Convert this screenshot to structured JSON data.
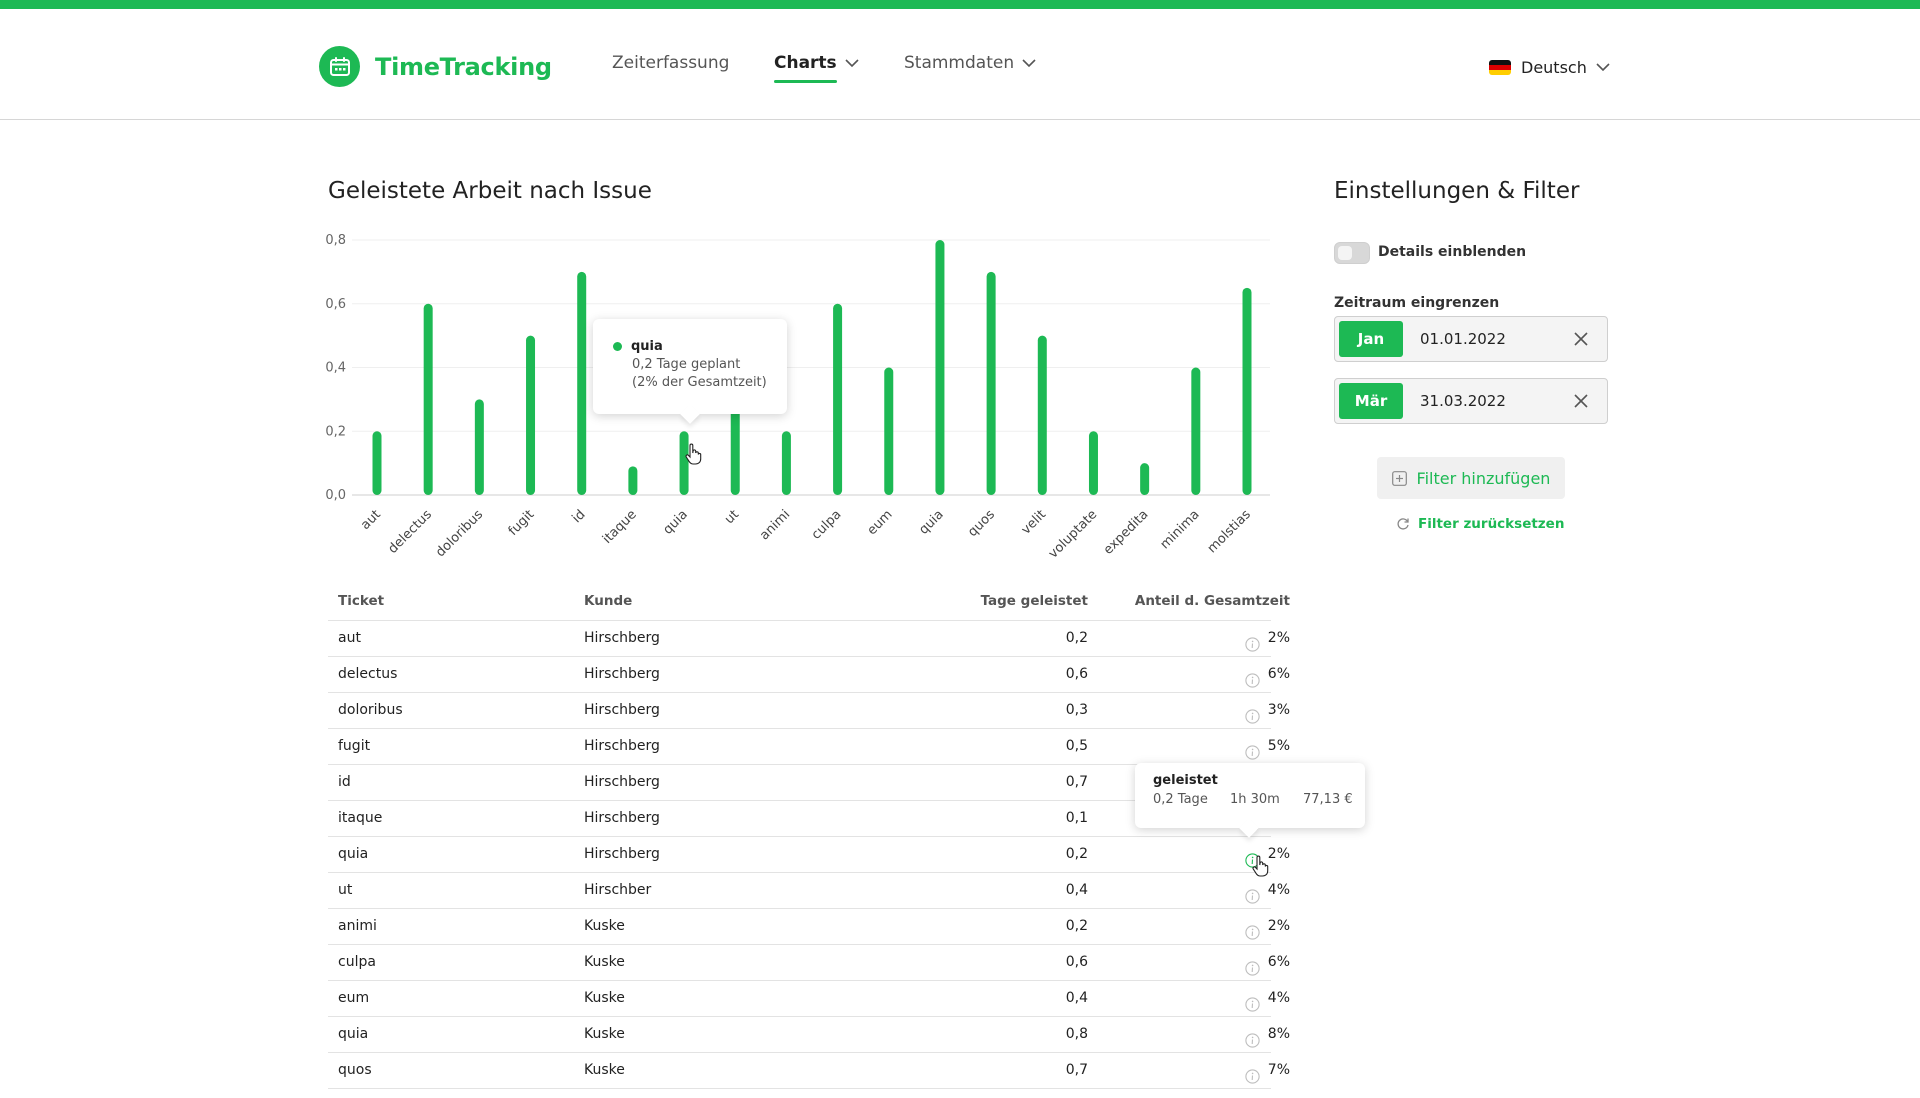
{
  "app": {
    "name": "TimeTracking",
    "accent": "#1db954"
  },
  "nav": {
    "items": [
      {
        "label": "Zeiterfassung"
      },
      {
        "label": "Charts"
      },
      {
        "label": "Stammdaten"
      }
    ],
    "language": "Deutsch"
  },
  "chart": {
    "title": "Geleistete Arbeit nach Issue",
    "tooltip": {
      "name": "quia",
      "line1": "0,2 Tage geplant",
      "line2": "(2% der Gesamtzeit)"
    }
  },
  "chart_data": {
    "type": "bar",
    "categories": [
      "aut",
      "delectus",
      "doloribus",
      "fugit",
      "id",
      "itaque",
      "quia",
      "ut",
      "animi",
      "culpa",
      "eum",
      "quia",
      "quos",
      "velit",
      "voluptate",
      "expedita",
      "minima",
      "molstias"
    ],
    "values": [
      0.2,
      0.6,
      0.3,
      0.5,
      0.7,
      0.09,
      0.2,
      0.4,
      0.2,
      0.6,
      0.4,
      0.8,
      0.7,
      0.5,
      0.2,
      0.1,
      0.4,
      0.65
    ],
    "yticks": [
      "0,0",
      "0,2",
      "0,4",
      "0,6",
      "0,8"
    ],
    "ylim": [
      0,
      0.8
    ],
    "grid": true,
    "legend": "none",
    "color": "#1db954"
  },
  "table": {
    "headers": {
      "ticket": "Ticket",
      "kunde": "Kunde",
      "tage": "Tage geleistet",
      "anteil": "Anteil d. Gesamtzeit"
    },
    "rows": [
      {
        "ticket": "aut",
        "kunde": "Hirschberg",
        "tage": "0,2",
        "anteil": "2%"
      },
      {
        "ticket": "delectus",
        "kunde": "Hirschberg",
        "tage": "0,6",
        "anteil": "6%"
      },
      {
        "ticket": "doloribus",
        "kunde": "Hirschberg",
        "tage": "0,3",
        "anteil": "3%"
      },
      {
        "ticket": "fugit",
        "kunde": "Hirschberg",
        "tage": "0,5",
        "anteil": "5%"
      },
      {
        "ticket": "id",
        "kunde": "Hirschberg",
        "tage": "0,7",
        "anteil": ""
      },
      {
        "ticket": "itaque",
        "kunde": "Hirschberg",
        "tage": "0,1",
        "anteil": ""
      },
      {
        "ticket": "quia",
        "kunde": "Hirschberg",
        "tage": "0,2",
        "anteil": "2%"
      },
      {
        "ticket": "ut",
        "kunde": "Hirschber",
        "tage": "0,4",
        "anteil": "4%"
      },
      {
        "ticket": "animi",
        "kunde": "Kuske",
        "tage": "0,2",
        "anteil": "2%"
      },
      {
        "ticket": "culpa",
        "kunde": "Kuske",
        "tage": "0,6",
        "anteil": "6%"
      },
      {
        "ticket": "eum",
        "kunde": "Kuske",
        "tage": "0,4",
        "anteil": "4%"
      },
      {
        "ticket": "quia",
        "kunde": "Kuske",
        "tage": "0,8",
        "anteil": "8%"
      },
      {
        "ticket": "quos",
        "kunde": "Kuske",
        "tage": "0,7",
        "anteil": "7%"
      }
    ],
    "row_tooltip": {
      "title": "geleistet",
      "tage": "0,2 Tage",
      "zeit": "1h 30m",
      "betrag": "77,13 €"
    }
  },
  "settings": {
    "title": "Einstellungen & Filter",
    "details_label": "Details einblenden",
    "details_on": false,
    "zeitraum_label": "Zeitraum eingrenzen",
    "from": {
      "month": "Jan",
      "date": "01.01.2022"
    },
    "to": {
      "month": "Mär",
      "date": "31.03.2022"
    },
    "add_filter": "Filter hinzufügen",
    "reset_filter": "Filter zurücksetzen"
  }
}
